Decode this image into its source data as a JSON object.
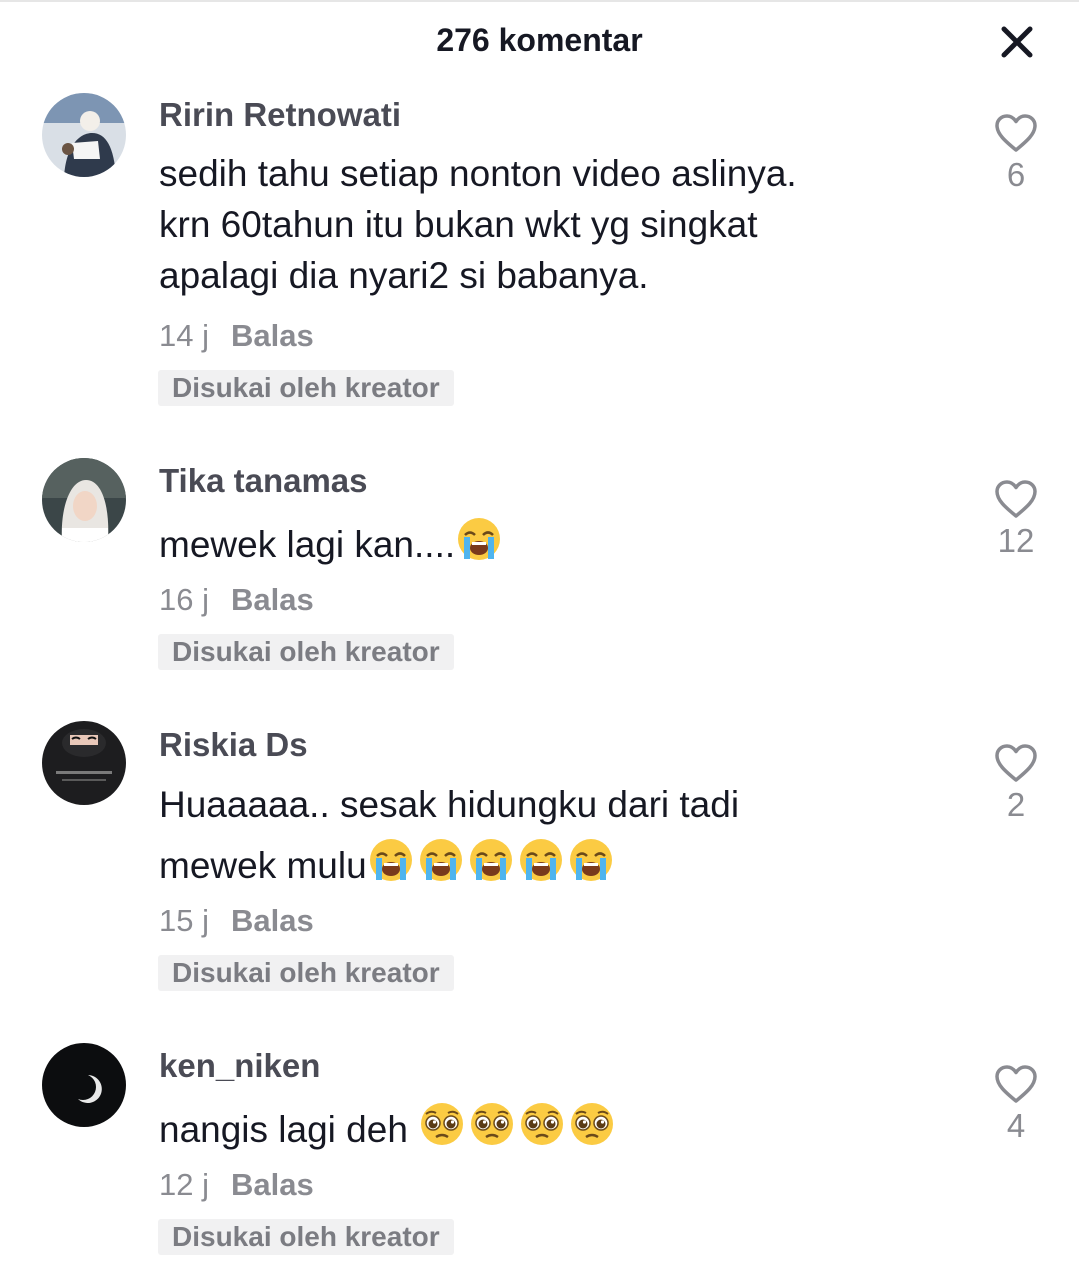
{
  "header": {
    "title": "276 komentar"
  },
  "comments": [
    {
      "username": "Ririn Retnowati",
      "lines": [
        "sedih tahu setiap nonton video aslinya.",
        "krn 60tahun itu bukan wkt yg singkat",
        "apalagi dia nyari2 si babanya."
      ],
      "time": "14 j",
      "reply": "Balas",
      "badge": "Disukai oleh kreator",
      "likes": "6"
    },
    {
      "username": "Tika tanamas",
      "lines": [
        "mewek lagi kan...."
      ],
      "emoji": {
        "name": "loudly-crying-face-emoji",
        "count": 1
      },
      "time": "16 j",
      "reply": "Balas",
      "badge": "Disukai oleh kreator",
      "likes": "12"
    },
    {
      "username": "Riskia Ds",
      "lines": [
        "Huaaaaa.. sesak hidungku dari tadi",
        "mewek mulu"
      ],
      "emoji": {
        "name": "loudly-crying-face-emoji",
        "count": 5
      },
      "time": "15 j",
      "reply": "Balas",
      "badge": "Disukai oleh kreator",
      "likes": "2"
    },
    {
      "username": "ken_niken",
      "lines": [
        "nangis lagi deh "
      ],
      "emoji": {
        "name": "pleading-face-emoji",
        "count": 4
      },
      "time": "12 j",
      "reply": "Balas",
      "badge": "Disukai oleh kreator",
      "likes": "4"
    }
  ],
  "icons": {
    "close": "close-icon",
    "like": "heart-outline-icon"
  },
  "colors": {
    "text": "#161823",
    "secondary": "#8a8b91",
    "badge_bg": "#f1f1f2"
  }
}
